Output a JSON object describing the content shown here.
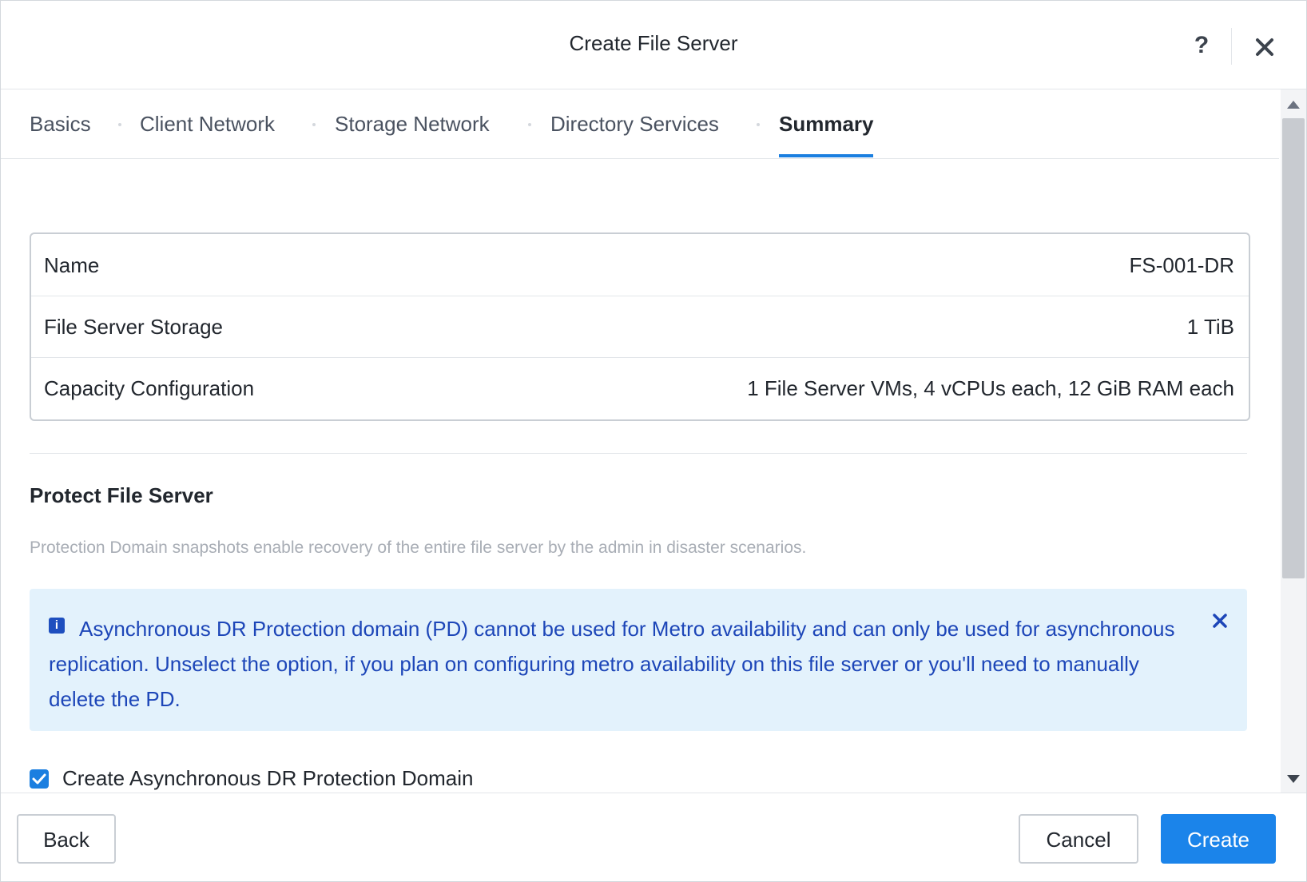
{
  "dialog": {
    "title": "Create File Server",
    "help_label": "?",
    "close_icon": "close-icon"
  },
  "tabs": [
    {
      "label": "Basics",
      "active": false
    },
    {
      "label": "Client Network",
      "active": false
    },
    {
      "label": "Storage Network",
      "active": false
    },
    {
      "label": "Directory Services",
      "active": false
    },
    {
      "label": "Summary",
      "active": true
    }
  ],
  "summary": {
    "rows": [
      {
        "label": "Name",
        "value": "FS-001-DR"
      },
      {
        "label": "File Server Storage",
        "value": "1 TiB"
      },
      {
        "label": "Capacity Configuration",
        "value": "1 File Server VMs, 4 vCPUs each, 12 GiB RAM each"
      }
    ]
  },
  "protect": {
    "title": "Protect File Server",
    "description": "Protection Domain snapshots enable recovery of the entire file server by the admin in disaster scenarios.",
    "info_icon_glyph": "i",
    "info_message": "Asynchronous DR Protection domain (PD) cannot be used for Metro availability and can only be used for asynchronous replication. Unselect the option, if you plan on configuring metro availability on this file server or you'll need to manually delete the PD.",
    "checkbox_label": "Create Asynchronous DR Protection Domain",
    "checkbox_checked": true
  },
  "footer": {
    "back_label": "Back",
    "cancel_label": "Cancel",
    "create_label": "Create"
  },
  "colors": {
    "accent": "#1b84ea",
    "info_bg": "#e3f2fc",
    "info_text": "#1d46b8"
  }
}
